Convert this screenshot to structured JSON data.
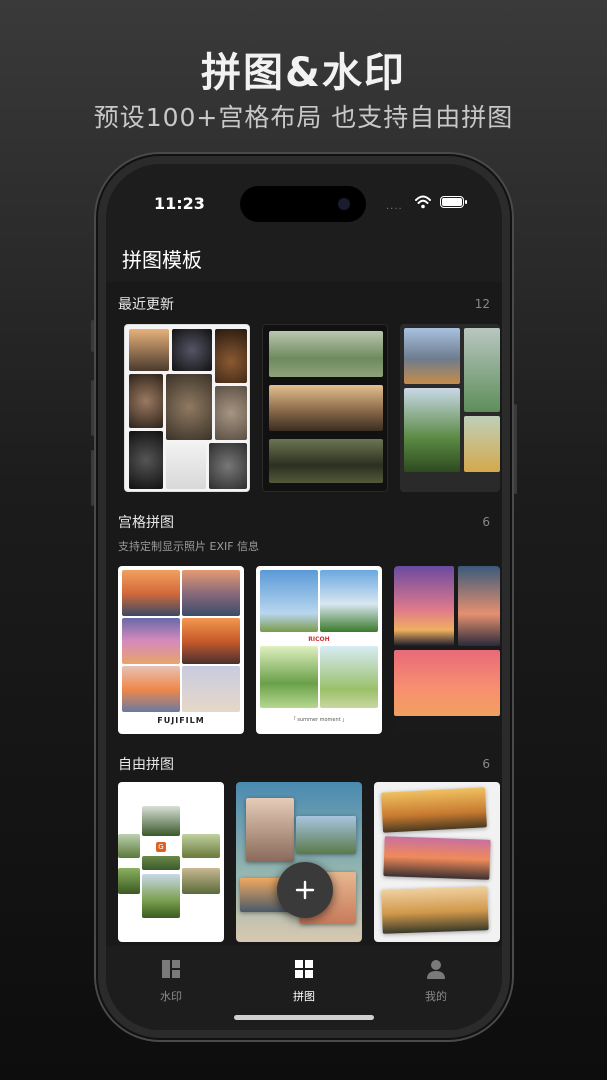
{
  "hero": {
    "title": "拼图&水印",
    "subtitle": "预设100+宫格布局 也支持自由拼图"
  },
  "statusbar": {
    "time": "11:23",
    "signal": "····"
  },
  "nav": {
    "title": "拼图模板"
  },
  "sections": {
    "recent": {
      "title": "最近更新",
      "count": "12"
    },
    "grid": {
      "title": "宫格拼图",
      "count": "6",
      "desc": "支持定制显示照片 EXIF 信息"
    },
    "free": {
      "title": "自由拼图",
      "count": "6"
    }
  },
  "card_texts": {
    "fujifilm": "FUJIFILM",
    "ricoh": "RICOH",
    "summer": "「 summer moment 」",
    "brand_g": "G"
  },
  "tabs": [
    {
      "label": "水印",
      "icon": "layout-icon",
      "active": false
    },
    {
      "label": "拼图",
      "icon": "grid-icon",
      "active": true
    },
    {
      "label": "我的",
      "icon": "person-icon",
      "active": false
    }
  ],
  "colors": {
    "accent": "#ffffff",
    "inactive": "#8a8a8a",
    "background": "#191919"
  }
}
